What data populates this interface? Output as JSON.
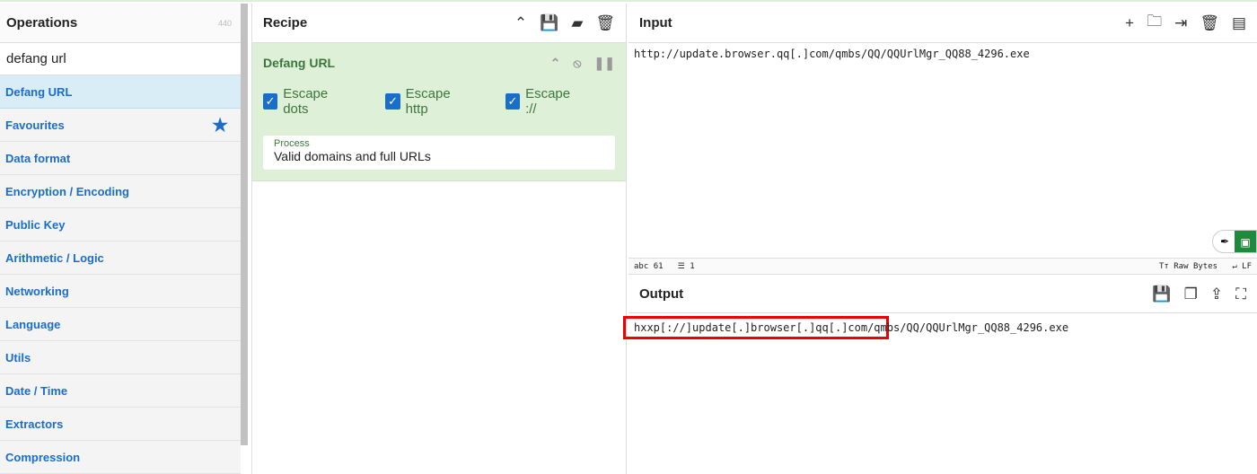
{
  "operations": {
    "title": "Operations",
    "count": "440",
    "search": "defang url",
    "items": [
      {
        "label": "Defang URL",
        "selected": true
      },
      {
        "label": "Favourites",
        "icon": "star-icon"
      },
      {
        "label": "Data format"
      },
      {
        "label": "Encryption / Encoding"
      },
      {
        "label": "Public Key"
      },
      {
        "label": "Arithmetic / Logic"
      },
      {
        "label": "Networking"
      },
      {
        "label": "Language"
      },
      {
        "label": "Utils"
      },
      {
        "label": "Date / Time"
      },
      {
        "label": "Extractors"
      },
      {
        "label": "Compression"
      }
    ]
  },
  "recipe": {
    "title": "Recipe",
    "op": {
      "name": "Defang URL",
      "checks": [
        {
          "label": "Escape dots",
          "checked": true
        },
        {
          "label": "Escape http",
          "checked": true
        },
        {
          "label": "Escape ://",
          "checked": true
        }
      ],
      "process_label": "Process",
      "process_value": "Valid domains and full URLs"
    }
  },
  "input": {
    "title": "Input",
    "value": "http://update.browser.qq[.]com/qmbs/QQ/QQUrlMgr_QQ88_4296.exe",
    "status": {
      "chars": "61",
      "lines": "1",
      "encoding": "Raw Bytes",
      "eol": "LF"
    }
  },
  "output": {
    "title": "Output",
    "value": "hxxp[://]update[.]browser[.]qq[.]com/qmbs/QQ/QQUrlMgr_QQ88_4296.exe"
  },
  "colors": {
    "accent": "#1a6ec9",
    "recipe_bg": "#dff0d8",
    "highlight": "#e00000"
  }
}
